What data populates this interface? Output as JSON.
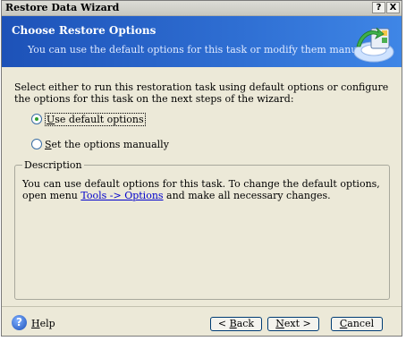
{
  "window": {
    "title": "Restore Data Wizard",
    "help_glyph": "?",
    "close_glyph": "X"
  },
  "banner": {
    "title": "Choose Restore Options",
    "subtitle": "You can use the default options for this task or modify them manually.",
    "icon": "restore-wizard-icon"
  },
  "instructions": "Select either to run this restoration task using default options or configure the options for this task on the next steps of the wizard:",
  "options": [
    {
      "label_first": "U",
      "label_rest": "se default options",
      "selected": true
    },
    {
      "label_first": "S",
      "label_rest": "et the options manually",
      "selected": false
    }
  ],
  "description": {
    "legend": "Description",
    "text_before": "You can use default options for this task. To change the default options, open menu ",
    "link": "Tools -> Options",
    "text_after": " and make all necessary changes."
  },
  "footer": {
    "help_label_first": "H",
    "help_label_rest": "elp",
    "back": {
      "first": "< ",
      "accel": "B",
      "rest": "ack"
    },
    "next": {
      "accel": "N",
      "rest": "ext >"
    },
    "cancel": {
      "accel": "C",
      "rest": "ancel"
    }
  },
  "colors": {
    "banner_start": "#1d52b8",
    "banner_end": "#3f86e6",
    "window_bg": "#ece9d8",
    "link": "#0000cc",
    "radio_selected": "#2fa02f"
  }
}
